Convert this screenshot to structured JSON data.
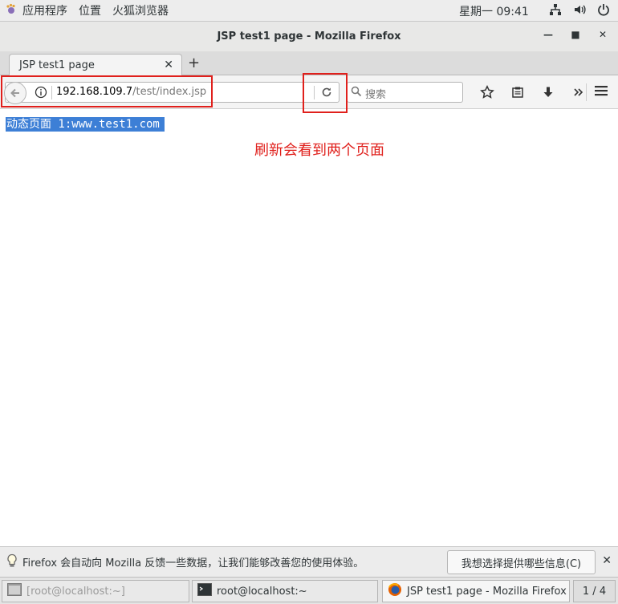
{
  "topbar": {
    "applications": "应用程序",
    "places": "位置",
    "app_name": "火狐浏览器",
    "clock": "星期一 09:41"
  },
  "window": {
    "title": "JSP test1 page - Mozilla Firefox"
  },
  "tabs": [
    {
      "label": "JSP test1 page"
    }
  ],
  "navbar": {
    "url_host": "192.168.109.7",
    "url_path": "/test/index.jsp",
    "search_placeholder": "搜索"
  },
  "content": {
    "selected_text": "动态页面 1:www.test1.com",
    "annotation": "刷新会看到两个页面"
  },
  "notification": {
    "text": "Firefox 会自动向 Mozilla 反馈一些数据，让我们能够改善您的使用体验。",
    "button": "我想选择提供哪些信息(C)"
  },
  "taskbar": {
    "items": [
      {
        "label": "[root@localhost:~]"
      },
      {
        "label": "root@localhost:~"
      },
      {
        "label": "JSP test1 page - Mozilla Firefox"
      }
    ],
    "pager": "1 / 4"
  },
  "colors": {
    "annotation_red": "#e0201c",
    "selection_blue": "#3d7fd6"
  }
}
